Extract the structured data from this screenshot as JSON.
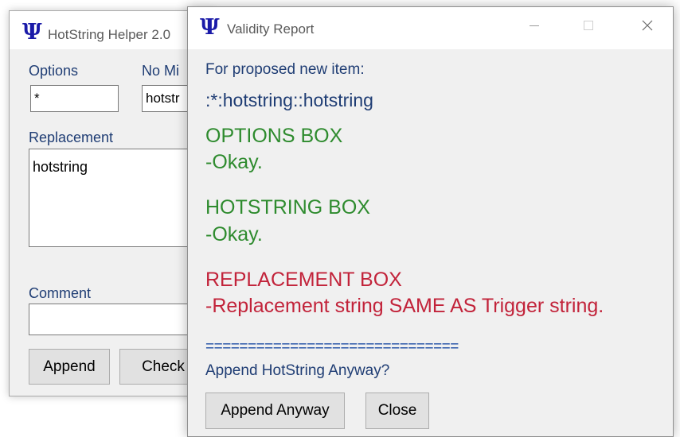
{
  "helper_window": {
    "title": "HotString Helper 2.0",
    "options_label": "Options",
    "options_value": "*",
    "hotstring_label": "No Mi",
    "hotstring_value": "hotstr",
    "replacement_label": "Replacement",
    "replacement_value": "hotstring",
    "comment_label": "Comment",
    "comment_value": "",
    "append_button": "Append",
    "check_button": "Check"
  },
  "report_window": {
    "title": "Validity Report",
    "intro": "For proposed new item:",
    "proposed_item": ":*:hotstring::hotstring",
    "sections": [
      {
        "heading": "OPTIONS BOX",
        "message": "-Okay.",
        "status": "ok"
      },
      {
        "heading": "HOTSTRING BOX",
        "message": "-Okay.",
        "status": "ok"
      },
      {
        "heading": "REPLACEMENT BOX",
        "message": "-Replacement string SAME AS Trigger string.",
        "status": "error"
      }
    ],
    "separator": "==============================",
    "question": "Append HotString Anyway?",
    "append_anyway_button": "Append Anyway",
    "close_button": "Close"
  },
  "icons": {
    "app_icon": "psi-icon",
    "minimize": "minimize-icon",
    "maximize": "maximize-icon",
    "close": "close-icon"
  },
  "colors": {
    "ok": "#2e8b2e",
    "error": "#c2233a",
    "label_blue": "#1f3d74",
    "separator_blue": "#1a4aa3",
    "icon_blue": "#1a1aa8"
  }
}
